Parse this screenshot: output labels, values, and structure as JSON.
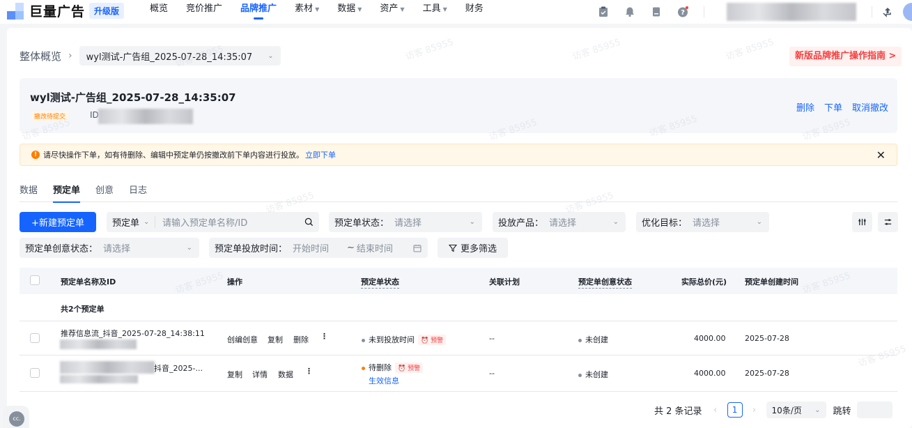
{
  "header": {
    "logo_text": "巨量广告",
    "upgrade_badge": "升级版",
    "nav": [
      {
        "label": "概览",
        "dropdown": false,
        "active": false
      },
      {
        "label": "竞价推广",
        "dropdown": false,
        "active": false
      },
      {
        "label": "品牌推广",
        "dropdown": false,
        "active": true
      },
      {
        "label": "素材",
        "dropdown": true,
        "active": false
      },
      {
        "label": "数据",
        "dropdown": true,
        "active": false
      },
      {
        "label": "资产",
        "dropdown": true,
        "active": false
      },
      {
        "label": "工具",
        "dropdown": true,
        "active": false
      },
      {
        "label": "财务",
        "dropdown": false,
        "active": false
      }
    ],
    "icons": [
      "clipboard-check-icon",
      "bell-icon",
      "document-icon",
      "help-icon"
    ],
    "colors": {
      "accent": "#1664ff",
      "danger": "#f53f3f",
      "warning": "#ff7d00"
    }
  },
  "breadcrumb": {
    "home": "整体概览",
    "current": "wyl测试-广告组_2025-07-28_14:35:07"
  },
  "guide_button": "新版品牌推广操作指南 >",
  "info_card": {
    "title": "wyl测试-广告组_2025-07-28_14:35:07",
    "status": "撤改待提交",
    "id_label": "ID",
    "actions": [
      "删除",
      "下单",
      "取消撤改"
    ]
  },
  "alert": {
    "text": "请尽快操作下单，如有待删除、编辑中预定单仍按撤改前下单内容进行投放。",
    "link": "立即下单"
  },
  "tabs": [
    {
      "label": "数据",
      "active": false
    },
    {
      "label": "预定单",
      "active": true
    },
    {
      "label": "创意",
      "active": false
    },
    {
      "label": "日志",
      "active": false
    }
  ],
  "toolbar": {
    "new_button": "+新建预定单",
    "search_type": "预定单",
    "search_placeholder": "请输入预定单名称/ID",
    "filters": [
      {
        "label": "预定单状态：",
        "placeholder": "请选择"
      },
      {
        "label": "投放产品：",
        "placeholder": "请选择"
      },
      {
        "label": "优化目标：",
        "placeholder": "请选择"
      },
      {
        "label": "预定单创意状态：",
        "placeholder": "请选择"
      }
    ],
    "time_filter": {
      "label": "预定单投放时间：",
      "start": "开始时间",
      "sep": "~",
      "end": "结束时间"
    },
    "more_filter": "更多筛选"
  },
  "table": {
    "columns": [
      "预定单名称及ID",
      "操作",
      "预定单状态",
      "关联计划",
      "预定单创意状态",
      "实际总价(元)",
      "预定单创建时间"
    ],
    "summary": "共2个预定单",
    "rows": [
      {
        "name": "推荐信息流_抖音_2025-07-28_14:38:11",
        "actions": [
          "创编创意",
          "复制",
          "删除"
        ],
        "status": "未到投放时间",
        "status_color": "#86909c",
        "tag": "预警",
        "status_link": "",
        "plan": "--",
        "creative_status": "未创建",
        "price": "4000.00",
        "created": "2025-07-28"
      },
      {
        "name": "抖音_2025-...",
        "actions": [
          "复制",
          "详情",
          "数据"
        ],
        "status": "待删除",
        "status_color": "#ff7d00",
        "tag": "预警",
        "status_link": "生效信息",
        "plan": "--",
        "creative_status": "未创建",
        "price": "4000.00",
        "created": "2025-07-28"
      }
    ]
  },
  "pagination": {
    "total": "共 2 条记录",
    "current": "1",
    "page_size": "10条/页",
    "jump": "跳转"
  },
  "watermark": "访客 85955"
}
